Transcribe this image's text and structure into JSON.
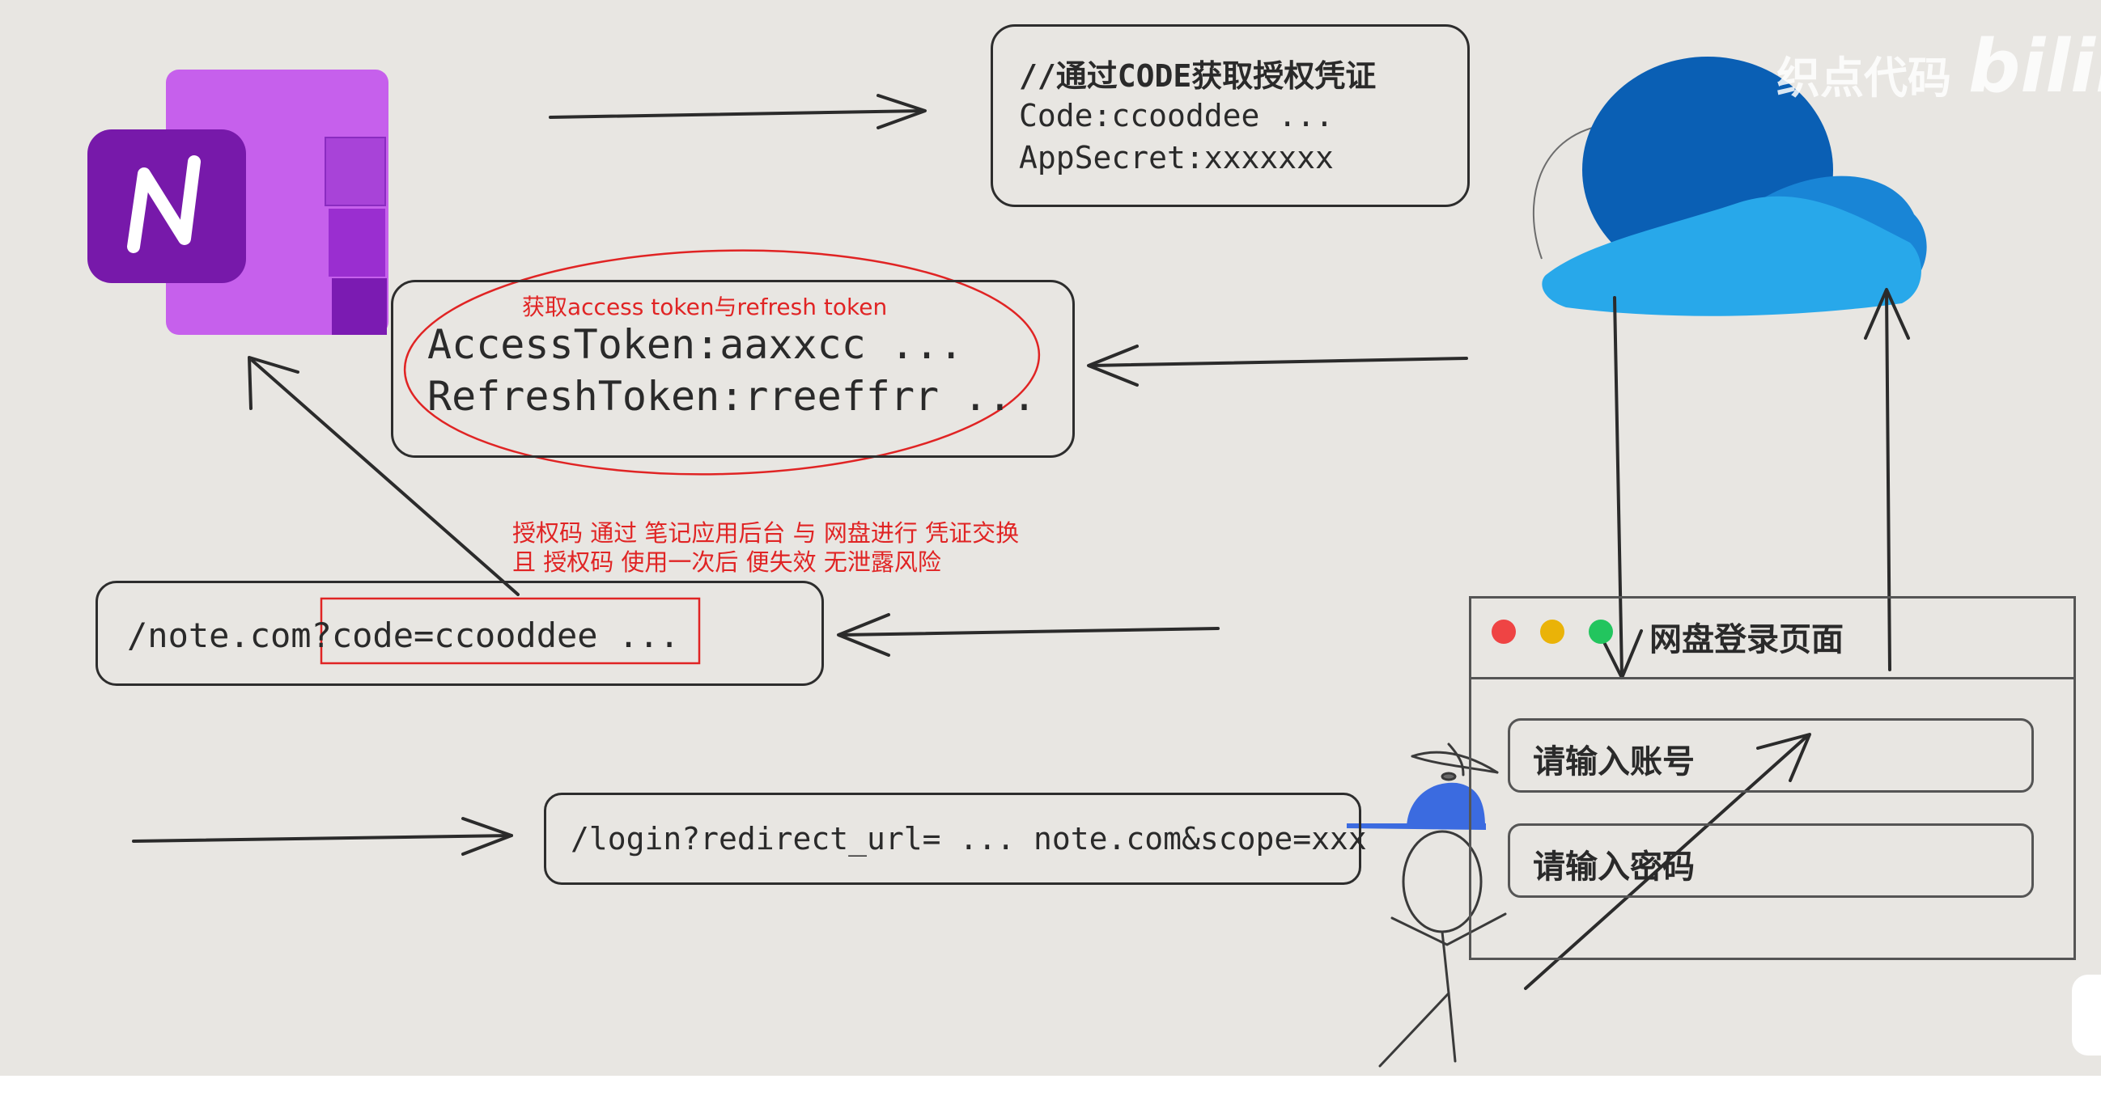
{
  "watermark": {
    "text": "织点代码",
    "brand": "bilib"
  },
  "step_exchange": {
    "comment": "//通过CODE获取授权凭证",
    "code_line": "Code:ccooddee ...",
    "secret_line": "AppSecret:xxxxxxx"
  },
  "step_tokens": {
    "note": "获取access token与refresh token",
    "access_line": "AccessToken:aaxxcc ...",
    "refresh_line": "RefreshToken:rreeffrr ..."
  },
  "auth_note": {
    "line1": "授权码 通过 笔记应用后台 与 网盘进行 凭证交换",
    "line2": "且 授权码 使用一次后 便失效 无泄露风险"
  },
  "callback_url": {
    "text": "/note.com?code=ccooddee ..."
  },
  "login_url": {
    "text": "/login?redirect_url= ... note.com&scope=xxx"
  },
  "browser": {
    "title": "网盘登录页面",
    "account_placeholder": "请输入账号",
    "password_placeholder": "请输入密码"
  },
  "colors": {
    "onenote_light": "#c660ec",
    "onenote_dark": "#7719aa",
    "cloud_dark": "#0a5fb4",
    "cloud_light": "#28a8ea",
    "annotation_red": "#e02424",
    "background": "#e8e6e2"
  },
  "icons": [
    "onenote-logo-icon",
    "onedrive-cloud-icon",
    "stick-figure-icon"
  ]
}
